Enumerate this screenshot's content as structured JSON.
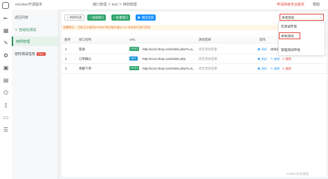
{
  "rail": {
    "icons": [
      "expand-icon",
      "calendar-icon",
      "wrench-icon",
      "cluster-icon",
      "toolbox-icon",
      "layers-icon",
      "share-icon",
      "document-icon",
      "clipboard-icon",
      "list-icon"
    ]
  },
  "topbar": {
    "title": "eoLinker开源版本",
    "breadcrumb": "接口管理 ＞ test ＞ 用例管理",
    "upgrade_label": "申请高级专业版本",
    "help_label": "帮助"
  },
  "subside": {
    "back_label": "返回列表",
    "group_label": "∨ 自动化测试",
    "items": [
      {
        "label": "用例管理",
        "active": true
      },
      {
        "label": "定时测试任务",
        "badge": "PRO",
        "active": false
      }
    ]
  },
  "toolbar": {
    "back_label": "< 用例列表",
    "add_label": "+ 添加接口",
    "batch_add_label": "+ 批量接口",
    "test_label": "▶ 测试全部"
  },
  "env": {
    "selected": "本地测试",
    "options": [
      "无测试环境",
      "本地测试",
      "管理测试环境"
    ]
  },
  "notice": "温馨提示：目前正在使用eolinker测试服务器(4.4.4.4)来进行接口测试",
  "table": {
    "columns": [
      "顺序",
      "接口名称",
      "URL",
      "测试结果",
      "操作"
    ],
    "rows": [
      {
        "order": "1",
        "name": "登录",
        "method": "POST",
        "method_color": "#30a46c",
        "url": "http://xcx2.shop.com/index.php?s=a...",
        "result": "尚无测试结果",
        "actions": [
          "测试",
          "修改测试环境"
        ]
      },
      {
        "order": "2",
        "name": "订单确认",
        "method": "GET",
        "method_color": "#1f97d8",
        "url": "http://xcx2.shop.com/index.php",
        "result": "尚无测试结果",
        "actions": [
          "测试",
          "修改",
          "删除"
        ]
      },
      {
        "order": "3",
        "name": "余额下单",
        "method": "POST",
        "method_color": "#30a46c",
        "url": "http://xcx2.shop.com/index.php?s=a...",
        "result": "尚无测试结果",
        "actions": [
          "测试",
          "修改",
          "删除"
        ]
      }
    ]
  },
  "watermark": "CSDN @孔皮哒",
  "colors": {
    "accent": "#30a46c",
    "danger": "#e0463b",
    "link": "#1890ff"
  }
}
